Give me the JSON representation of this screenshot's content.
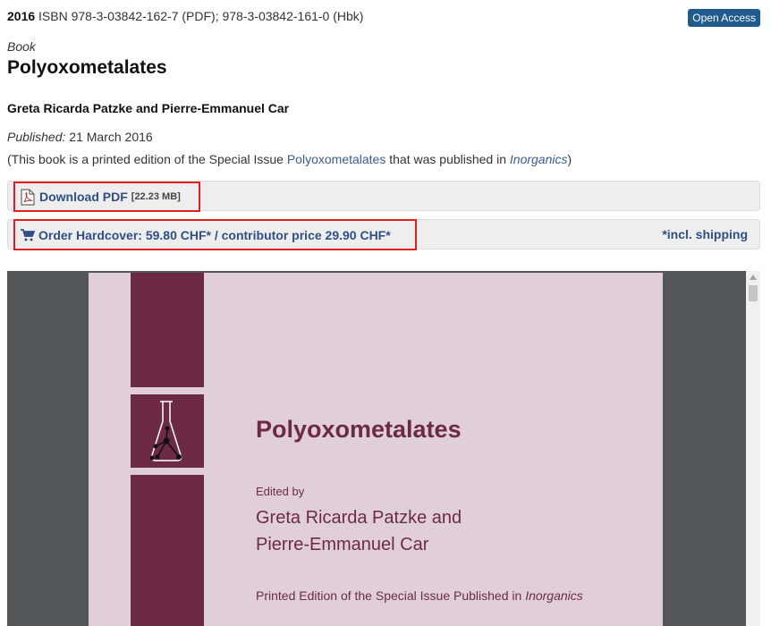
{
  "meta": {
    "year": "2016",
    "isbn_text": "ISBN 978-3-03842-162-7 (PDF); 978-3-03842-161-0 (Hbk)",
    "badge": "Open Access"
  },
  "book": {
    "type_label": "Book",
    "title": "Polyoxometalates",
    "authors": "Greta Ricarda Patzke and Pierre-Emmanuel Car",
    "published_label": "Published:",
    "published_date": "21 March 2016",
    "note_prefix": "(This book is a printed edition of the Special Issue ",
    "note_issue": "Polyoxometalates",
    "note_mid": " that was published in ",
    "note_journal": "Inorganics",
    "note_suffix": ")"
  },
  "actions": {
    "download_label": "Download PDF",
    "download_size": "[22.23 MB]",
    "order_label": "Order Hardcover: 59.80 CHF* / contributor price 29.90 CHF*",
    "shipping_note": "*incl. shipping"
  },
  "preview": {
    "title": "Polyoxometalates",
    "edited_by": "Edited by",
    "editor1": "Greta Ricarda Patzke and",
    "editor2": "Pierre-Emmanuel Car",
    "printed_prefix": "Printed Edition of the Special Issue Published in ",
    "printed_journal": "Inorganics"
  },
  "colors": {
    "link": "#2f4f85",
    "highlight": "#e02020",
    "cover_accent": "#6d2a46",
    "cover_bg": "#e0cfd8",
    "badge_bg": "#1f5b8d"
  },
  "icons": [
    "pdf-file-icon",
    "shopping-cart-icon",
    "flask-molecule-icon"
  ]
}
